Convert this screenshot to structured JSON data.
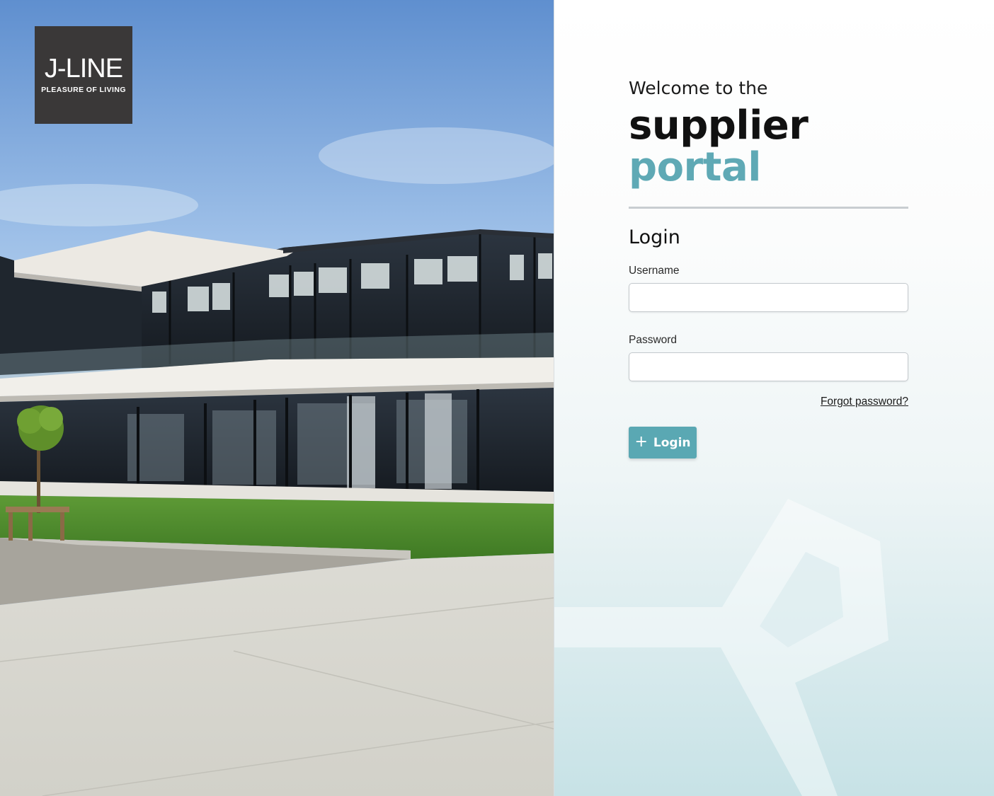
{
  "brand": {
    "logo_name": "J-LINE",
    "logo_tagline": "PLEASURE OF LIVING"
  },
  "hero": {
    "welcome": "Welcome to the",
    "title_line1": "supplier",
    "title_line2": "portal"
  },
  "login": {
    "heading": "Login",
    "username_label": "Username",
    "username_value": "",
    "password_label": "Password",
    "password_value": "",
    "forgot_password": "Forgot password?",
    "button_label": "Login",
    "button_icon": "plus-icon"
  },
  "colors": {
    "accent": "#5fa9b5",
    "button": "#5aa8b3",
    "logo_background": "#3a3838"
  }
}
